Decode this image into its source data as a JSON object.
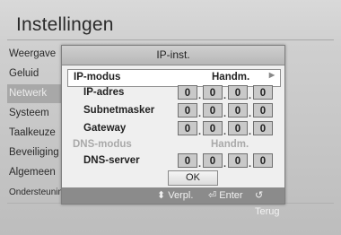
{
  "screen": {
    "title": "Instellingen"
  },
  "menu": {
    "items": [
      "Weergave",
      "Geluid",
      "Netwerk",
      "Systeem",
      "Taalkeuze",
      "Beveiliging",
      "Algemeen",
      "Ondersteuning"
    ],
    "selected_index": 2
  },
  "dialog": {
    "title": "IP-inst.",
    "rows": [
      {
        "label": "IP-modus",
        "value": "Handm."
      },
      {
        "label": "IP-adres",
        "octets": [
          "0",
          "0",
          "0",
          "0"
        ]
      },
      {
        "label": "Subnetmasker",
        "octets": [
          "0",
          "0",
          "0",
          "0"
        ]
      },
      {
        "label": "Gateway",
        "octets": [
          "0",
          "0",
          "0",
          "0"
        ]
      },
      {
        "label": "DNS-modus",
        "value": "Handm."
      },
      {
        "label": "DNS-server",
        "octets": [
          "0",
          "0",
          "0",
          "0"
        ]
      }
    ],
    "ok_label": "OK",
    "footer": {
      "move": "Verpl.",
      "enter": "Enter",
      "back": "Terug"
    },
    "footer_icons": {
      "move": "updown-icon",
      "enter": "enter-icon",
      "back": "return-icon"
    }
  }
}
